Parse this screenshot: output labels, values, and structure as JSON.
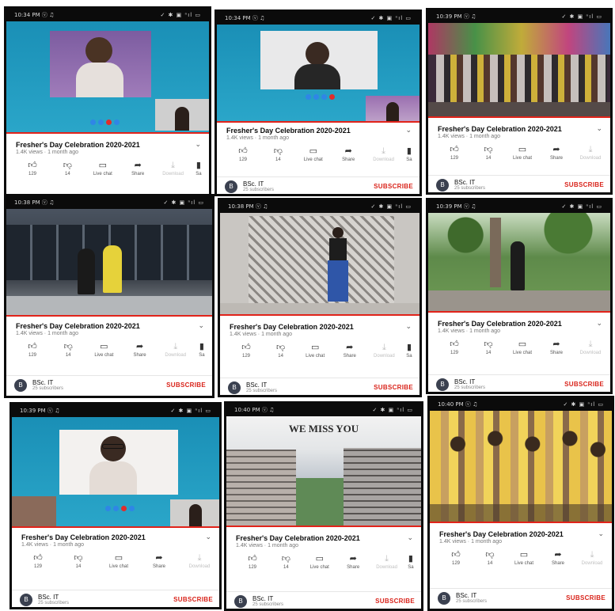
{
  "common": {
    "title": "Fresher's Day Celebration 2020-2021",
    "views": "1.4K views · 1 month ago",
    "likes": "129",
    "dislikes": "14",
    "live_chat": "Live chat",
    "share": "Share",
    "download": "Download",
    "save": "Sa",
    "channel_name": "BSc. IT",
    "channel_initial": "B",
    "subscribers": "25 subscribers",
    "subscribe": "SUBSCRIBE",
    "chevron": "⌄"
  },
  "status_icons": "✓ ✱ ▣ ⁿıl ▭",
  "screens": [
    {
      "time": "10:34 PM ⓥ ♫",
      "scene": "video-call-boy"
    },
    {
      "time": "10:34 PM ⓥ ♫",
      "scene": "video-call-girl"
    },
    {
      "time": "10:39 PM ⓥ ♫",
      "scene": "dance-crowd"
    },
    {
      "time": "10:38 PM ⓥ ♫",
      "scene": "dance-studio"
    },
    {
      "time": "10:38 PM ⓥ ♫",
      "scene": "dance-wall"
    },
    {
      "time": "10:39 PM ⓥ ♫",
      "scene": "dance-garden"
    },
    {
      "time": "10:39 PM ⓥ ♫",
      "scene": "video-call-glasses"
    },
    {
      "time": "10:40 PM ⓥ ♫",
      "scene": "campus"
    },
    {
      "time": "10:40 PM ⓥ ♫",
      "scene": "group-photo"
    }
  ],
  "campus_caption": "WE MISS YOU",
  "colors": {
    "subscribe": "#d9231a",
    "progress": "#e1231a",
    "call_button": "#2f86e6"
  }
}
